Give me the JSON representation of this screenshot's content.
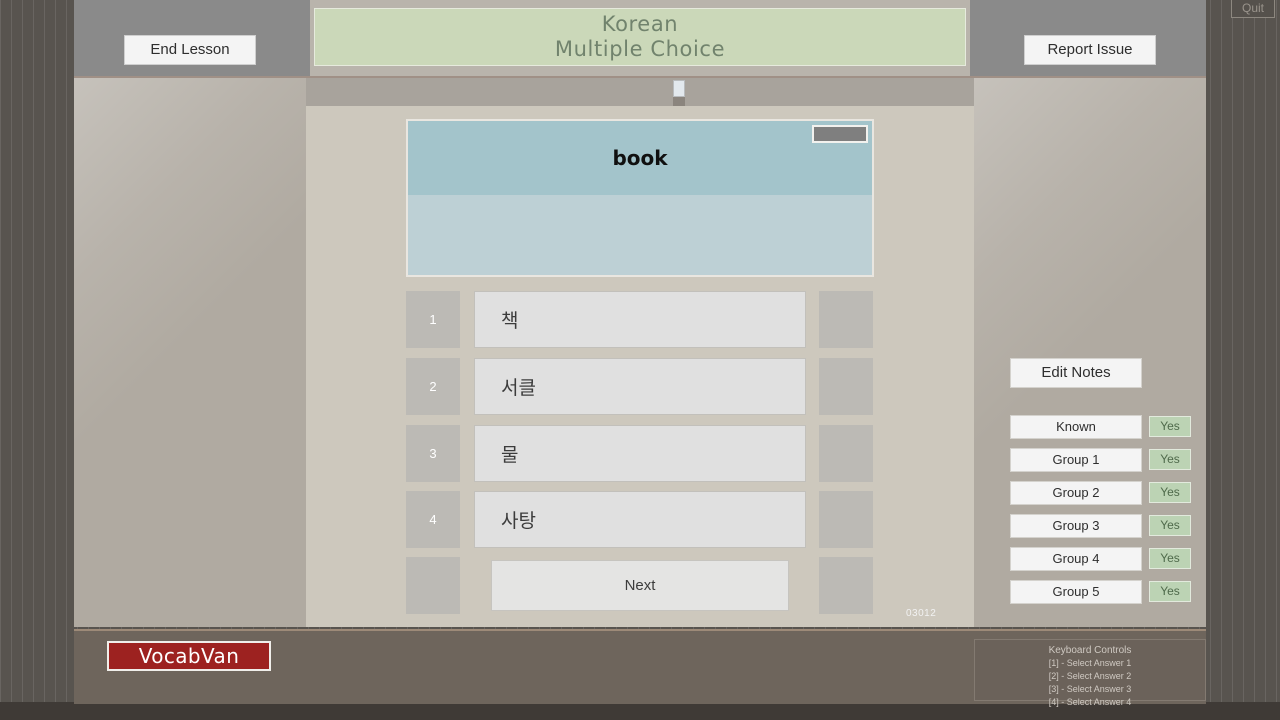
{
  "window": {
    "quit_label": "Quit"
  },
  "header": {
    "end_lesson_label": "End Lesson",
    "report_issue_label": "Report Issue",
    "title_line1": "Korean",
    "title_line2": "Multiple Choice"
  },
  "prompt": {
    "word": "book",
    "audio_button_label": ""
  },
  "answers": [
    {
      "number": "1",
      "text": "책"
    },
    {
      "number": "2",
      "text": "서클"
    },
    {
      "number": "3",
      "text": "물"
    },
    {
      "number": "4",
      "text": "사탕"
    }
  ],
  "next_label": "Next",
  "card_id": "03012",
  "notes": {
    "edit_notes_label": "Edit Notes"
  },
  "groups": [
    {
      "label": "Known",
      "state": "Yes"
    },
    {
      "label": "Group 1",
      "state": "Yes"
    },
    {
      "label": "Group 2",
      "state": "Yes"
    },
    {
      "label": "Group 3",
      "state": "Yes"
    },
    {
      "label": "Group 4",
      "state": "Yes"
    },
    {
      "label": "Group 5",
      "state": "Yes"
    }
  ],
  "footer": {
    "logo": "VocabVan",
    "keyboard": {
      "title": "Keyboard Controls",
      "lines": [
        "[1] - Select Answer 1",
        "[2] - Select Answer 2",
        "[3] - Select Answer 3",
        "[4] - Select Answer 4"
      ]
    }
  },
  "colors": {
    "accent_red": "#9d2220",
    "title_green": "#cbd8b9",
    "prompt_top": "#a3c4cb",
    "prompt_bottom": "#bdd0d5",
    "yes_green": "#bcd3b4"
  }
}
